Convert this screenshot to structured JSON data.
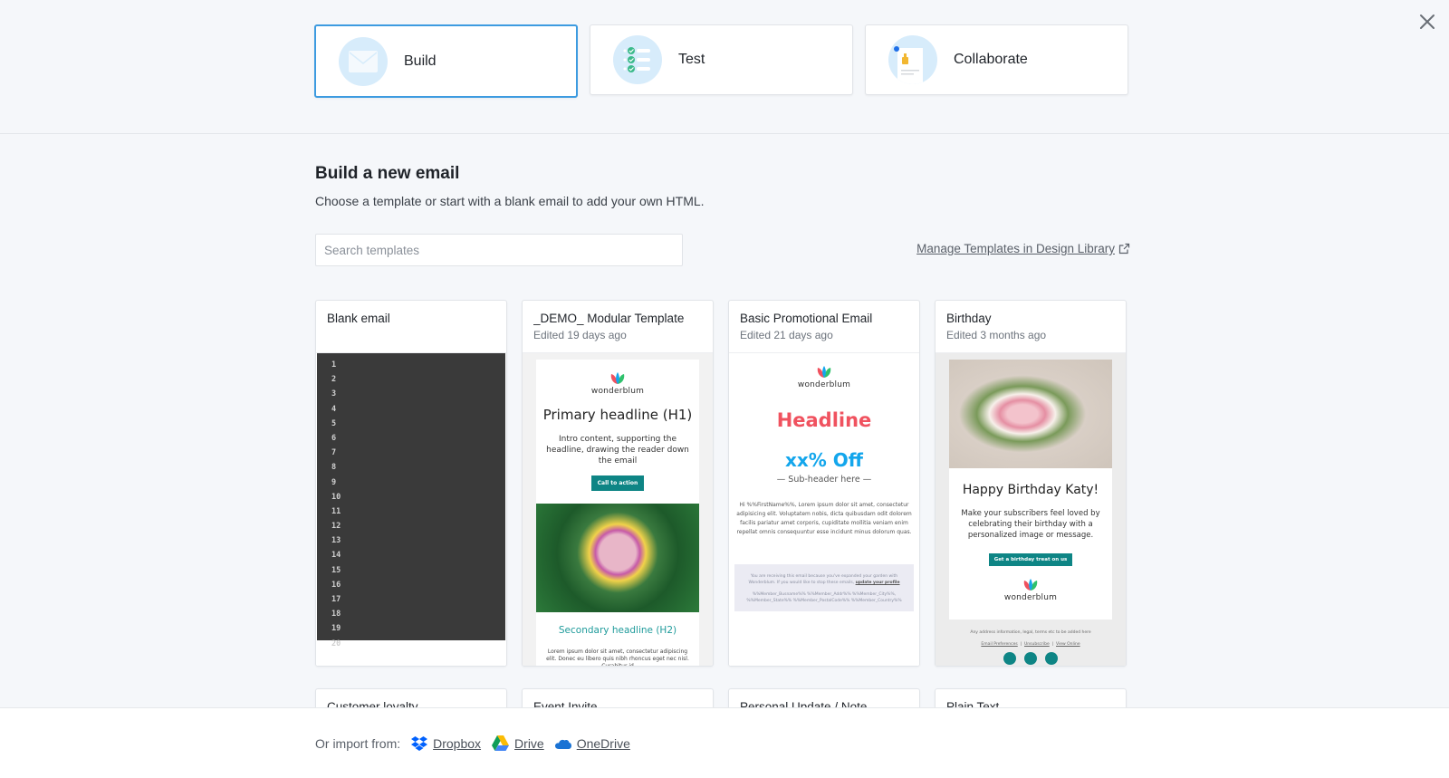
{
  "modes": [
    {
      "label": "Build",
      "icon": "envelope-icon",
      "active": true
    },
    {
      "label": "Test",
      "icon": "checklist-icon",
      "active": false
    },
    {
      "label": "Collaborate",
      "icon": "thumbs-up-document-icon",
      "active": false
    }
  ],
  "colors": {
    "accent": "#3d9be0",
    "teal": "#0e8585",
    "promo_headline": "#f0525f",
    "promo_offer": "#13a6ec"
  },
  "header": {
    "title": "Build a new email",
    "subtitle": "Choose a template or start with a blank email to add your own HTML."
  },
  "search": {
    "placeholder": "Search templates",
    "value": ""
  },
  "manage_link": {
    "label": "Manage Templates in Design Library"
  },
  "templates": [
    {
      "title": "Blank email",
      "edited": "",
      "line_numbers": [
        "1",
        "2",
        "3",
        "4",
        "5",
        "6",
        "7",
        "8",
        "9",
        "10",
        "11",
        "12",
        "13",
        "14",
        "15",
        "16",
        "17",
        "18",
        "19",
        "20"
      ]
    },
    {
      "title": "_DEMO_ Modular Template",
      "edited": "Edited 19 days ago",
      "preview": {
        "brand": "wonderblum",
        "h1": "Primary headline (H1)",
        "intro": "Intro content, supporting the headline, drawing the reader down the email",
        "cta": "Call to action",
        "h2": "Secondary headline (H2)",
        "body": "Lorem ipsum dolor sit amet, consectetur adipiscing elit. Donec eu libero quis nibh rhoncus eget nec nisl. Curabitur id"
      }
    },
    {
      "title": "Basic Promotional Email",
      "edited": "Edited 21 days ago",
      "preview": {
        "brand": "wonderblum",
        "headline": "Headline",
        "offer": "xx% Off",
        "subheader": "— Sub-header here —",
        "body": "Hi %%FirstName%%, Lorem ipsum dolor sit amet, consectetur adipisicing elit. Voluptatem nobis, dicta quibusdam odit dolorem facilis pariatur amet corporis, cupiditate mollitia veniam enim repellat omnis consequuntur esse incidunt minus dolorum quas.",
        "footer_notice": "You are receiving this email because you've expanded your garden with Wonderblum. If you would like to stop these emails,",
        "footer_link": "update your profile",
        "footer_address": "%%Member_Busname%% %%Member_Addr%% %%Member_City%%, %%Member_State%% %%Member_PostalCode%% %%Member_Country%%"
      }
    },
    {
      "title": "Birthday",
      "edited": "Edited 3 months ago",
      "preview": {
        "brand": "wonderblum",
        "heading": "Happy Birthday Katy!",
        "body": "Make your subscribers feel loved by celebrating their birthday with a personalized image or message.",
        "cta": "Get a birthday treat on us",
        "legal": "Any address information, legal, terms etc to be added here",
        "links": [
          "Email Preferences",
          "Unsubscribe",
          "View Online"
        ]
      }
    }
  ],
  "more_templates": [
    {
      "title": "Customer loyalty"
    },
    {
      "title": "Event Invite"
    },
    {
      "title": "Personal Update / Note"
    },
    {
      "title": "Plain Text"
    }
  ],
  "import": {
    "label": "Or import from:",
    "sources": [
      "Dropbox",
      "Drive",
      "OneDrive"
    ]
  }
}
